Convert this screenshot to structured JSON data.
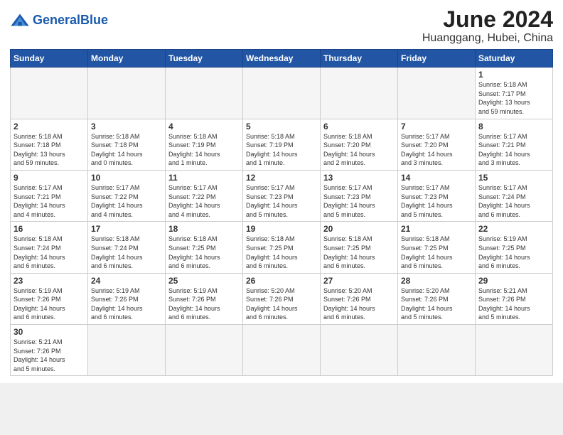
{
  "header": {
    "logo_general": "General",
    "logo_blue": "Blue",
    "month_title": "June 2024",
    "location": "Huanggang, Hubei, China"
  },
  "weekdays": [
    "Sunday",
    "Monday",
    "Tuesday",
    "Wednesday",
    "Thursday",
    "Friday",
    "Saturday"
  ],
  "weeks": [
    [
      {
        "day": "",
        "info": ""
      },
      {
        "day": "",
        "info": ""
      },
      {
        "day": "",
        "info": ""
      },
      {
        "day": "",
        "info": ""
      },
      {
        "day": "",
        "info": ""
      },
      {
        "day": "",
        "info": ""
      },
      {
        "day": "1",
        "info": "Sunrise: 5:18 AM\nSunset: 7:17 PM\nDaylight: 13 hours\nand 59 minutes."
      }
    ],
    [
      {
        "day": "2",
        "info": "Sunrise: 5:18 AM\nSunset: 7:18 PM\nDaylight: 13 hours\nand 59 minutes."
      },
      {
        "day": "3",
        "info": "Sunrise: 5:18 AM\nSunset: 7:18 PM\nDaylight: 14 hours\nand 0 minutes."
      },
      {
        "day": "4",
        "info": "Sunrise: 5:18 AM\nSunset: 7:19 PM\nDaylight: 14 hours\nand 1 minute."
      },
      {
        "day": "5",
        "info": "Sunrise: 5:18 AM\nSunset: 7:19 PM\nDaylight: 14 hours\nand 1 minute."
      },
      {
        "day": "6",
        "info": "Sunrise: 5:18 AM\nSunset: 7:20 PM\nDaylight: 14 hours\nand 2 minutes."
      },
      {
        "day": "7",
        "info": "Sunrise: 5:17 AM\nSunset: 7:20 PM\nDaylight: 14 hours\nand 3 minutes."
      },
      {
        "day": "8",
        "info": "Sunrise: 5:17 AM\nSunset: 7:21 PM\nDaylight: 14 hours\nand 3 minutes."
      }
    ],
    [
      {
        "day": "9",
        "info": "Sunrise: 5:17 AM\nSunset: 7:21 PM\nDaylight: 14 hours\nand 4 minutes."
      },
      {
        "day": "10",
        "info": "Sunrise: 5:17 AM\nSunset: 7:22 PM\nDaylight: 14 hours\nand 4 minutes."
      },
      {
        "day": "11",
        "info": "Sunrise: 5:17 AM\nSunset: 7:22 PM\nDaylight: 14 hours\nand 4 minutes."
      },
      {
        "day": "12",
        "info": "Sunrise: 5:17 AM\nSunset: 7:23 PM\nDaylight: 14 hours\nand 5 minutes."
      },
      {
        "day": "13",
        "info": "Sunrise: 5:17 AM\nSunset: 7:23 PM\nDaylight: 14 hours\nand 5 minutes."
      },
      {
        "day": "14",
        "info": "Sunrise: 5:17 AM\nSunset: 7:23 PM\nDaylight: 14 hours\nand 5 minutes."
      },
      {
        "day": "15",
        "info": "Sunrise: 5:17 AM\nSunset: 7:24 PM\nDaylight: 14 hours\nand 6 minutes."
      }
    ],
    [
      {
        "day": "16",
        "info": "Sunrise: 5:18 AM\nSunset: 7:24 PM\nDaylight: 14 hours\nand 6 minutes."
      },
      {
        "day": "17",
        "info": "Sunrise: 5:18 AM\nSunset: 7:24 PM\nDaylight: 14 hours\nand 6 minutes."
      },
      {
        "day": "18",
        "info": "Sunrise: 5:18 AM\nSunset: 7:25 PM\nDaylight: 14 hours\nand 6 minutes."
      },
      {
        "day": "19",
        "info": "Sunrise: 5:18 AM\nSunset: 7:25 PM\nDaylight: 14 hours\nand 6 minutes."
      },
      {
        "day": "20",
        "info": "Sunrise: 5:18 AM\nSunset: 7:25 PM\nDaylight: 14 hours\nand 6 minutes."
      },
      {
        "day": "21",
        "info": "Sunrise: 5:18 AM\nSunset: 7:25 PM\nDaylight: 14 hours\nand 6 minutes."
      },
      {
        "day": "22",
        "info": "Sunrise: 5:19 AM\nSunset: 7:25 PM\nDaylight: 14 hours\nand 6 minutes."
      }
    ],
    [
      {
        "day": "23",
        "info": "Sunrise: 5:19 AM\nSunset: 7:26 PM\nDaylight: 14 hours\nand 6 minutes."
      },
      {
        "day": "24",
        "info": "Sunrise: 5:19 AM\nSunset: 7:26 PM\nDaylight: 14 hours\nand 6 minutes."
      },
      {
        "day": "25",
        "info": "Sunrise: 5:19 AM\nSunset: 7:26 PM\nDaylight: 14 hours\nand 6 minutes."
      },
      {
        "day": "26",
        "info": "Sunrise: 5:20 AM\nSunset: 7:26 PM\nDaylight: 14 hours\nand 6 minutes."
      },
      {
        "day": "27",
        "info": "Sunrise: 5:20 AM\nSunset: 7:26 PM\nDaylight: 14 hours\nand 6 minutes."
      },
      {
        "day": "28",
        "info": "Sunrise: 5:20 AM\nSunset: 7:26 PM\nDaylight: 14 hours\nand 5 minutes."
      },
      {
        "day": "29",
        "info": "Sunrise: 5:21 AM\nSunset: 7:26 PM\nDaylight: 14 hours\nand 5 minutes."
      }
    ],
    [
      {
        "day": "30",
        "info": "Sunrise: 5:21 AM\nSunset: 7:26 PM\nDaylight: 14 hours\nand 5 minutes."
      },
      {
        "day": "",
        "info": ""
      },
      {
        "day": "",
        "info": ""
      },
      {
        "day": "",
        "info": ""
      },
      {
        "day": "",
        "info": ""
      },
      {
        "day": "",
        "info": ""
      },
      {
        "day": "",
        "info": ""
      }
    ]
  ]
}
